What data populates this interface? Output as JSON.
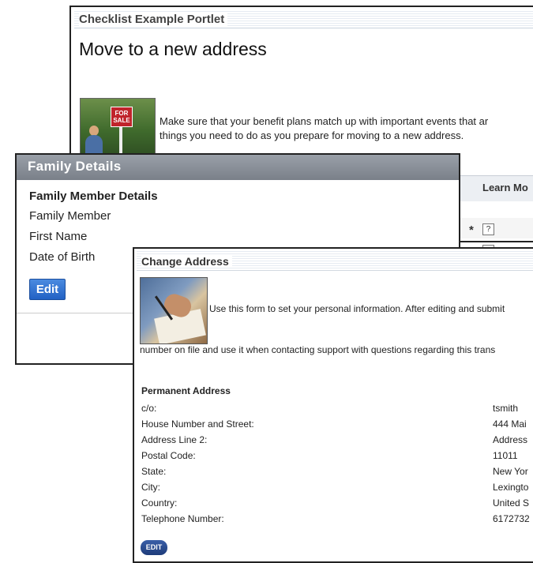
{
  "checklist": {
    "portlet_title": "Checklist Example Portlet",
    "heading": "Move to a new address",
    "image_sign_text": "FOR SALE",
    "intro_line1": "Make sure that your benefit plans match up with important events that ar",
    "intro_line2": "things you need to do as you prepare for moving to a new address.",
    "learn_more_label": "Learn Mo",
    "required_marker": "*",
    "help_icon_label": "?"
  },
  "family": {
    "title": "Family Details",
    "section_title": "Family Member Details",
    "fields": [
      "Family Member",
      "First Name",
      "Date of Birth"
    ],
    "edit_label": "Edit"
  },
  "change_address": {
    "title": "Change Address",
    "intro_line1": "Use this form to set your personal information. After editing and submit",
    "intro_line2": "number on file and use it when contacting support with questions regarding this trans",
    "section_title": "Permanent Address",
    "fields": [
      {
        "label": "c/o:",
        "value": "tsmith"
      },
      {
        "label": "House Number and Street:",
        "value": "444 Mai"
      },
      {
        "label": "Address Line 2:",
        "value": "Address"
      },
      {
        "label": "Postal Code:",
        "value": "11011"
      },
      {
        "label": "State:",
        "value": "New Yor"
      },
      {
        "label": "City:",
        "value": "Lexingto"
      },
      {
        "label": "Country:",
        "value": "United S"
      },
      {
        "label": "Telephone Number:",
        "value": "6172732"
      }
    ],
    "edit_label": "EDIT"
  },
  "colors": {
    "family_header": "#8a9099",
    "edit_button": "#2f6fd0",
    "edit_small": "#24407f",
    "sign_red": "#c0242b"
  }
}
